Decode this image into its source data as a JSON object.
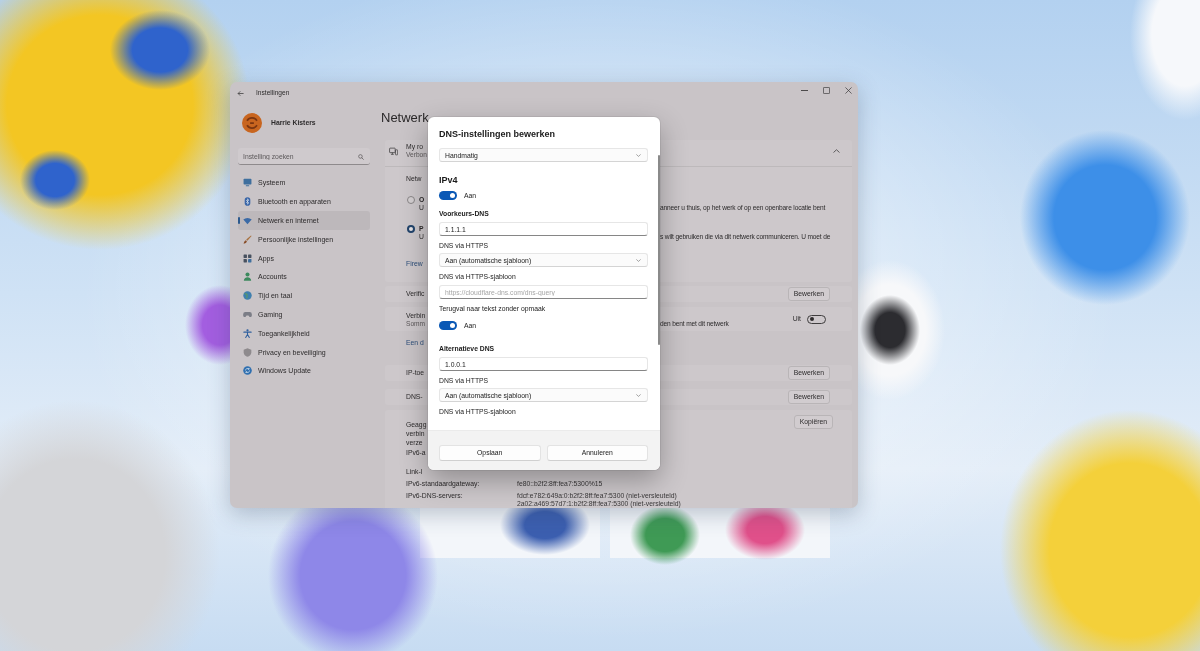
{
  "window": {
    "title": "Instellingen"
  },
  "profile": {
    "name": "Harrie Kisters"
  },
  "search": {
    "placeholder": "Instelling zoeken"
  },
  "sidebar": {
    "items": [
      {
        "label": "Systeem",
        "selected": false
      },
      {
        "label": "Bluetooth en apparaten",
        "selected": false
      },
      {
        "label": "Netwerk en internet",
        "selected": true
      },
      {
        "label": "Persoonlijke instellingen",
        "selected": false
      },
      {
        "label": "Apps",
        "selected": false
      },
      {
        "label": "Accounts",
        "selected": false
      },
      {
        "label": "Tijd en taal",
        "selected": false
      },
      {
        "label": "Gaming",
        "selected": false
      },
      {
        "label": "Toegankelijkheid",
        "selected": false
      },
      {
        "label": "Privacy en beveiliging",
        "selected": false
      },
      {
        "label": "Windows Update",
        "selected": false
      }
    ]
  },
  "main": {
    "heading": "Netwerk",
    "connection_card": {
      "title": "My ro",
      "subtitle": "Verbon",
      "expanded": true
    },
    "network_profile": {
      "label": "Netw",
      "options": [
        {
          "title": "O",
          "description": "U",
          "description_continued": "anneer u thuis, op het werk of op een openbare locatie bent",
          "selected": false
        },
        {
          "title": "P",
          "description": "U",
          "description_continued": "s wilt gebruiken die via dit netwerk communiceren. U moet de",
          "selected": true
        }
      ],
      "link": "Firew"
    },
    "rows": [
      {
        "kind": "button",
        "label": "Verific",
        "button": "Bewerken"
      },
      {
        "kind": "toggle",
        "label": "Verbin",
        "description": "Somm",
        "description_continued": "den bent met dit netwerk",
        "state_label": "Uit",
        "on": false
      },
      {
        "kind": "link",
        "label": "Een d"
      },
      {
        "kind": "button",
        "label": "IP-toe",
        "button": "Bewerken"
      },
      {
        "kind": "button",
        "label": "DNS-",
        "button": "Bewerken"
      }
    ],
    "properties": {
      "button": "Kopiëren",
      "items": [
        {
          "label": "Geagg verbin verze"
        },
        {
          "label": "IPv6-a"
        },
        {
          "label": "Link-l"
        },
        {
          "label": "IPv6-standaardgateway:",
          "values": [
            "fe80::b2f2:8ff:fea7:5300%15"
          ]
        },
        {
          "label": "IPv6-DNS-servers:",
          "values": [
            "fdcf:e782:649a:0:b2f2:8ff:fea7:5300 (niet-versleuteld)",
            "2a02:a469:57d7:1:b2f2:8ff:fea7:5300 (niet-versleuteld)"
          ]
        }
      ]
    }
  },
  "dialog": {
    "title": "DNS-instellingen bewerken",
    "items": [
      {
        "kind": "select",
        "value": "Handmatig"
      },
      {
        "kind": "heading",
        "text": "IPv4"
      },
      {
        "kind": "toggle",
        "on": true,
        "label": "Aan"
      },
      {
        "kind": "title",
        "text": "Voorkeurs-DNS"
      },
      {
        "kind": "input",
        "value": "1.1.1.1"
      },
      {
        "kind": "label",
        "text": "DNS via HTTPS"
      },
      {
        "kind": "select",
        "value": "Aan (automatische sjabloon)"
      },
      {
        "kind": "label",
        "text": "DNS via HTTPS-sjabloon"
      },
      {
        "kind": "input",
        "placeholder": "https://cloudflare-dns.com/dns-query"
      },
      {
        "kind": "label",
        "text": "Terugval naar tekst zonder opmaak"
      },
      {
        "kind": "toggle",
        "on": true,
        "label": "Aan"
      },
      {
        "kind": "title",
        "text": "Alternatieve DNS"
      },
      {
        "kind": "input",
        "value": "1.0.0.1"
      },
      {
        "kind": "label",
        "text": "DNS via HTTPS"
      },
      {
        "kind": "select",
        "value": "Aan (automatische sjabloon)"
      },
      {
        "kind": "label",
        "text": "DNS via HTTPS-sjabloon"
      }
    ],
    "buttons": [
      "Opslaan",
      "Annuleren"
    ]
  }
}
